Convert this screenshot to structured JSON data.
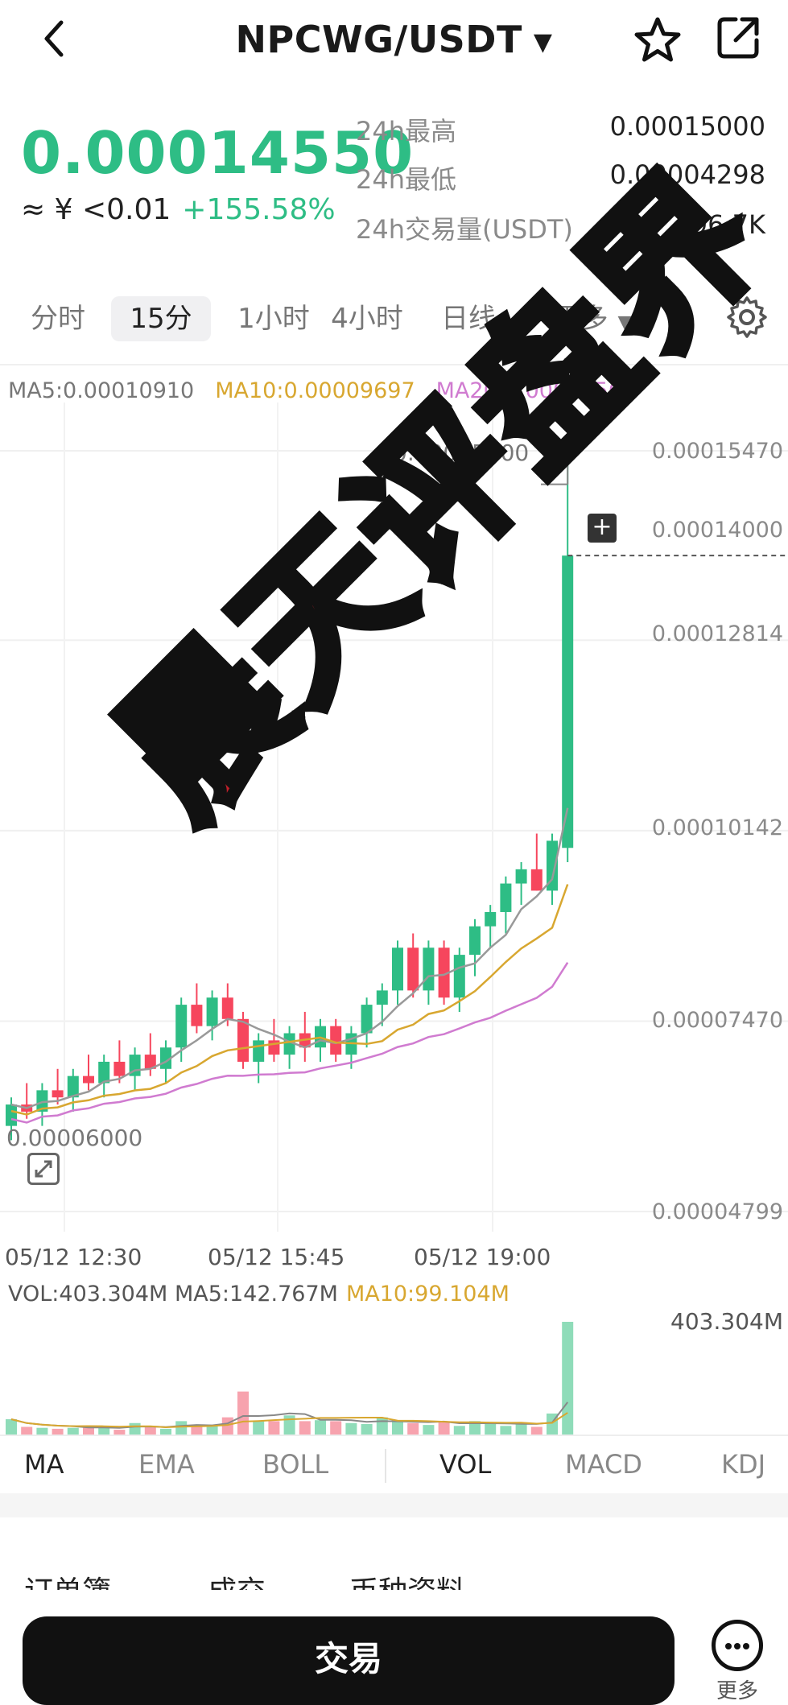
{
  "header": {
    "pair": "NPCWG/USDT"
  },
  "ticker": {
    "last_price": "0.00014550",
    "approx_cny": "≈ ¥ <0.01",
    "change_pct": "+155.58%",
    "stats": [
      {
        "label": "24h最高",
        "value": "0.00015000"
      },
      {
        "label": "24h最低",
        "value": "0.00004298"
      },
      {
        "label": "24h交易量(USDT)",
        "value": "296.7K"
      }
    ]
  },
  "tabs": [
    {
      "label": "分时",
      "active": false
    },
    {
      "label": "15分",
      "active": true
    },
    {
      "label": "1小时",
      "active": false
    },
    {
      "label": "4小时",
      "active": false
    },
    {
      "label": "日线",
      "active": false
    },
    {
      "label": "更多",
      "active": false
    }
  ],
  "chart": {
    "ma5_label": "MA5:0.00010910",
    "ma10_label": "MA10:0.00009697",
    "ma20_label": "MA20:0.00008563",
    "high_marker": "0.00015000",
    "y_labels": [
      "0.00015470",
      "0.00014000",
      "0.00012814",
      "0.00010142",
      "0.00007470",
      "0.00004799"
    ],
    "left_marker": "0.00006000",
    "x_labels": [
      "05/12 12:30",
      "05/12 15:45",
      "05/12 19:00"
    ],
    "vol_label": "VOL:403.304M",
    "vol_ma5_label": "MA5:142.767M",
    "vol_ma10_label": "MA10:99.104M",
    "vol_max": "403.304M",
    "colors": {
      "up": "#2ebd85",
      "down": "#f6465d",
      "ma5": "#999999",
      "ma10": "#d8a730",
      "ma20": "#d07bd0"
    }
  },
  "chart_data": {
    "type": "candlestick",
    "x_ticks": [
      "05/12 12:30",
      "05/12 15:45",
      "05/12 19:00"
    ],
    "ylim": [
      4.799e-05,
      0.0001547
    ],
    "y_ticks": [
      0.0001547,
      0.00012814,
      0.00010142,
      7.47e-05,
      4.799e-05
    ],
    "candles": [
      {
        "o": 6e-05,
        "h": 6.4e-05,
        "l": 5.8e-05,
        "c": 6.3e-05
      },
      {
        "o": 6.3e-05,
        "h": 6.6e-05,
        "l": 6.1e-05,
        "c": 6.2e-05
      },
      {
        "o": 6.2e-05,
        "h": 6.6e-05,
        "l": 6e-05,
        "c": 6.5e-05
      },
      {
        "o": 6.5e-05,
        "h": 6.8e-05,
        "l": 6.3e-05,
        "c": 6.4e-05
      },
      {
        "o": 6.4e-05,
        "h": 6.8e-05,
        "l": 6.2e-05,
        "c": 6.7e-05
      },
      {
        "o": 6.7e-05,
        "h": 7e-05,
        "l": 6.5e-05,
        "c": 6.6e-05
      },
      {
        "o": 6.6e-05,
        "h": 7e-05,
        "l": 6.4e-05,
        "c": 6.9e-05
      },
      {
        "o": 6.9e-05,
        "h": 7.2e-05,
        "l": 6.6e-05,
        "c": 6.7e-05
      },
      {
        "o": 6.7e-05,
        "h": 7.1e-05,
        "l": 6.5e-05,
        "c": 7e-05
      },
      {
        "o": 7e-05,
        "h": 7.3e-05,
        "l": 6.7e-05,
        "c": 6.8e-05
      },
      {
        "o": 6.8e-05,
        "h": 7.2e-05,
        "l": 6.6e-05,
        "c": 7.1e-05
      },
      {
        "o": 7.1e-05,
        "h": 7.8e-05,
        "l": 6.9e-05,
        "c": 7.7e-05
      },
      {
        "o": 7.7e-05,
        "h": 8e-05,
        "l": 7.3e-05,
        "c": 7.4e-05
      },
      {
        "o": 7.4e-05,
        "h": 7.9e-05,
        "l": 7.2e-05,
        "c": 7.8e-05
      },
      {
        "o": 7.8e-05,
        "h": 8e-05,
        "l": 7.4e-05,
        "c": 7.5e-05
      },
      {
        "o": 7.5e-05,
        "h": 7.6e-05,
        "l": 6.8e-05,
        "c": 6.9e-05
      },
      {
        "o": 6.9e-05,
        "h": 7.3e-05,
        "l": 6.6e-05,
        "c": 7.2e-05
      },
      {
        "o": 7.2e-05,
        "h": 7.5e-05,
        "l": 6.9e-05,
        "c": 7e-05
      },
      {
        "o": 7e-05,
        "h": 7.4e-05,
        "l": 6.8e-05,
        "c": 7.3e-05
      },
      {
        "o": 7.3e-05,
        "h": 7.6e-05,
        "l": 6.9e-05,
        "c": 7.1e-05
      },
      {
        "o": 7.1e-05,
        "h": 7.5e-05,
        "l": 6.9e-05,
        "c": 7.4e-05
      },
      {
        "o": 7.4e-05,
        "h": 7.5e-05,
        "l": 6.9e-05,
        "c": 7e-05
      },
      {
        "o": 7e-05,
        "h": 7.4e-05,
        "l": 6.8e-05,
        "c": 7.3e-05
      },
      {
        "o": 7.3e-05,
        "h": 7.8e-05,
        "l": 7.1e-05,
        "c": 7.7e-05
      },
      {
        "o": 7.7e-05,
        "h": 8e-05,
        "l": 7.4e-05,
        "c": 7.9e-05
      },
      {
        "o": 7.9e-05,
        "h": 8.6e-05,
        "l": 7.7e-05,
        "c": 8.5e-05
      },
      {
        "o": 8.5e-05,
        "h": 8.7e-05,
        "l": 7.8e-05,
        "c": 7.9e-05
      },
      {
        "o": 7.9e-05,
        "h": 8.6e-05,
        "l": 7.7e-05,
        "c": 8.5e-05
      },
      {
        "o": 8.5e-05,
        "h": 8.6e-05,
        "l": 7.7e-05,
        "c": 7.8e-05
      },
      {
        "o": 7.8e-05,
        "h": 8.5e-05,
        "l": 7.6e-05,
        "c": 8.4e-05
      },
      {
        "o": 8.4e-05,
        "h": 8.9e-05,
        "l": 8.1e-05,
        "c": 8.8e-05
      },
      {
        "o": 8.8e-05,
        "h": 9.1e-05,
        "l": 8.5e-05,
        "c": 9e-05
      },
      {
        "o": 9e-05,
        "h": 9.5e-05,
        "l": 8.7e-05,
        "c": 9.4e-05
      },
      {
        "o": 9.4e-05,
        "h": 9.7e-05,
        "l": 9.1e-05,
        "c": 9.6e-05
      },
      {
        "o": 9.6e-05,
        "h": 0.000101,
        "l": 9.3e-05,
        "c": 9.3e-05
      },
      {
        "o": 9.3e-05,
        "h": 0.000101,
        "l": 9.1e-05,
        "c": 0.0001
      },
      {
        "o": 9.9e-05,
        "h": 0.000155,
        "l": 9.7e-05,
        "c": 0.00014
      }
    ],
    "volume": [
      16,
      8,
      7,
      6,
      7,
      9,
      8,
      5,
      12,
      8,
      6,
      14,
      10,
      10,
      18,
      45,
      14,
      14,
      20,
      14,
      15,
      14,
      12,
      11,
      18,
      14,
      12,
      10,
      14,
      9,
      14,
      12,
      9,
      12,
      8,
      22,
      118
    ]
  }
}
